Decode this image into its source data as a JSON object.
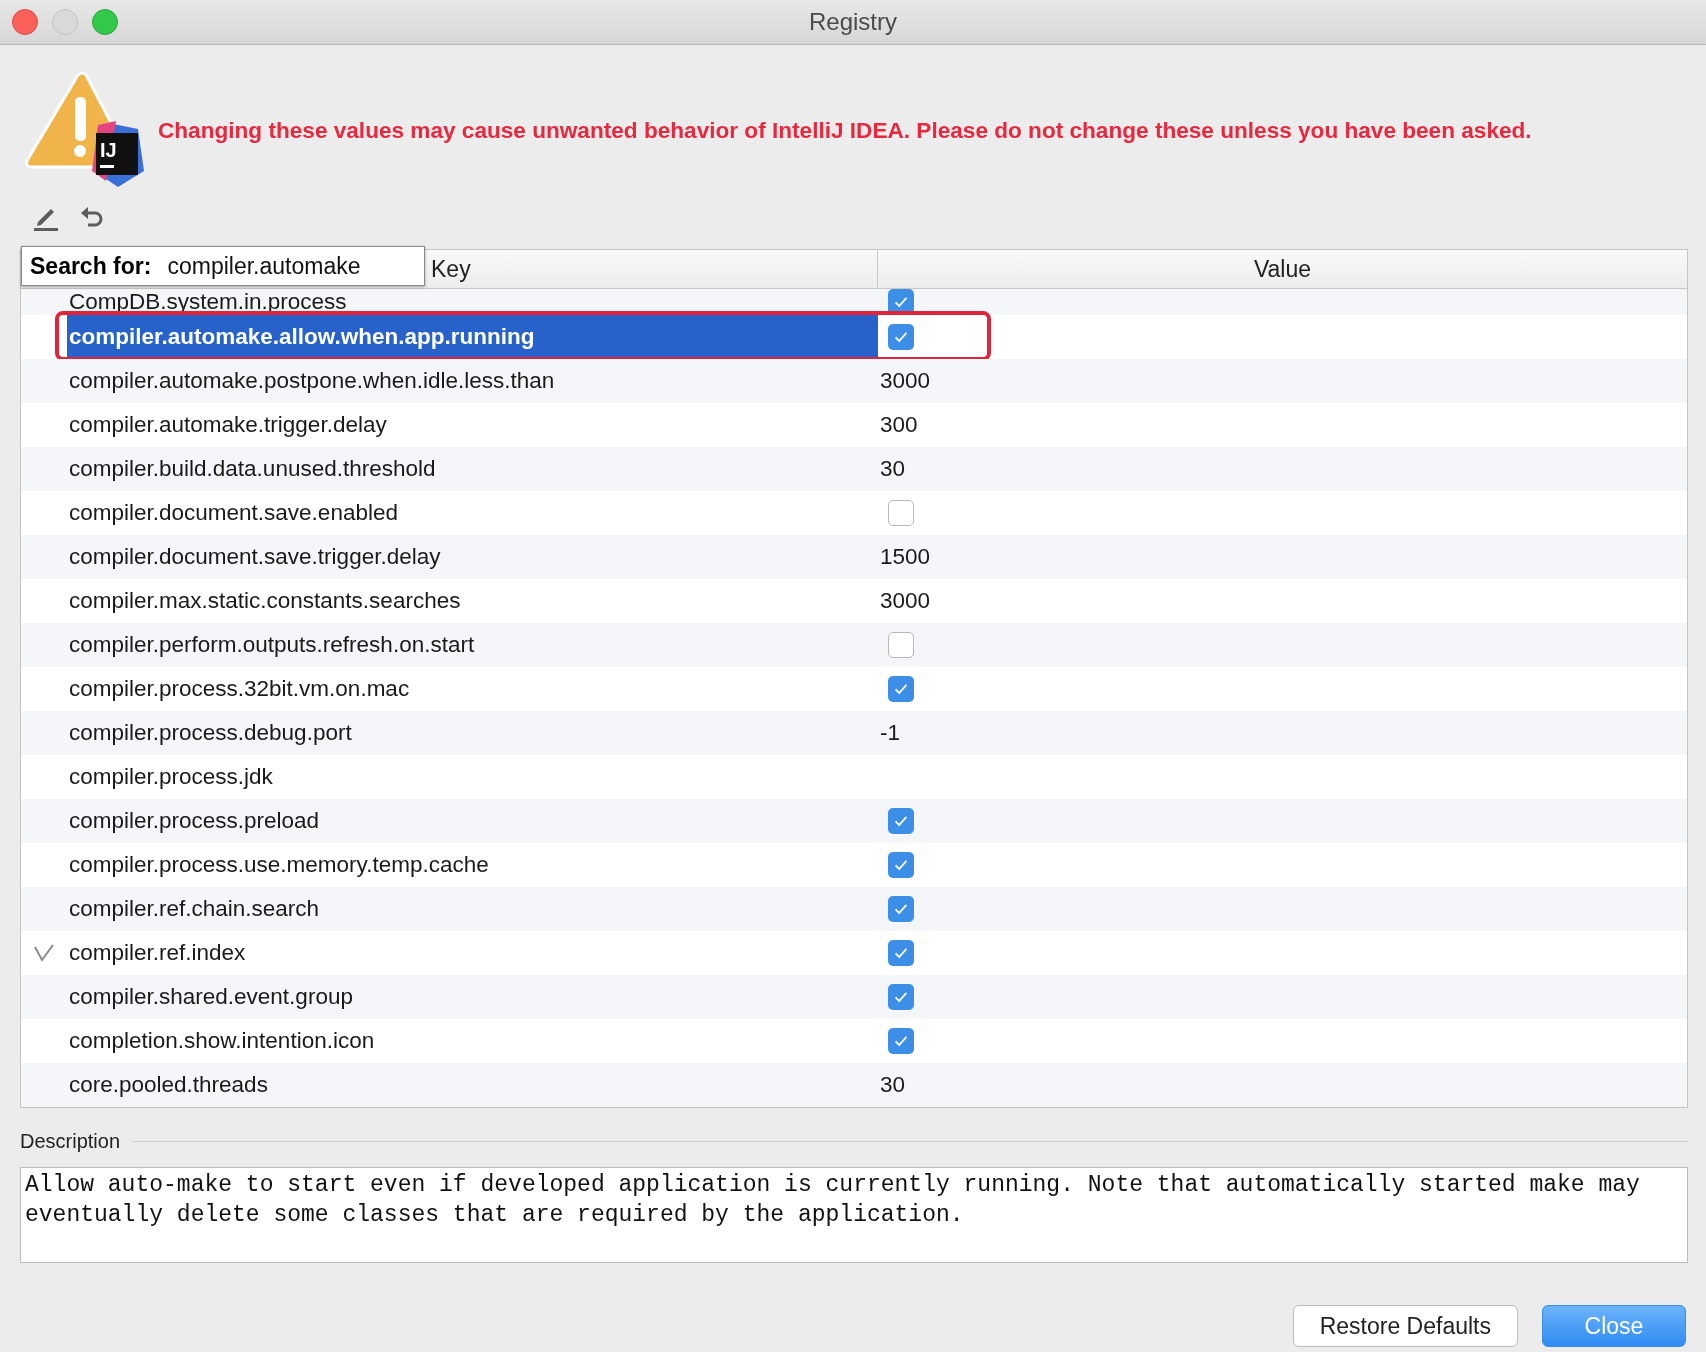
{
  "window": {
    "title": "Registry"
  },
  "badge": "IJ",
  "warning": "Changing these values may cause unwanted behavior of IntelliJ IDEA. Please do not change these unless you have been asked.",
  "search": {
    "label": "Search for:",
    "value": "compiler.automake"
  },
  "table": {
    "columns": [
      "Key",
      "Value"
    ],
    "rows": [
      {
        "key": "CompDB.system.in.process",
        "kind": "bool",
        "checked": true,
        "selected": false,
        "outlined": false,
        "changed": false
      },
      {
        "key": "compiler.automake.allow.when.app.running",
        "kind": "bool",
        "checked": true,
        "selected": true,
        "outlined": true,
        "changed": false
      },
      {
        "key": "compiler.automake.postpone.when.idle.less.than",
        "kind": "text",
        "value": "3000",
        "selected": false,
        "outlined": false,
        "changed": false
      },
      {
        "key": "compiler.automake.trigger.delay",
        "kind": "text",
        "value": "300",
        "selected": false,
        "outlined": false,
        "changed": false
      },
      {
        "key": "compiler.build.data.unused.threshold",
        "kind": "text",
        "value": "30",
        "selected": false,
        "outlined": false,
        "changed": false
      },
      {
        "key": "compiler.document.save.enabled",
        "kind": "bool",
        "checked": false,
        "selected": false,
        "outlined": false,
        "changed": false
      },
      {
        "key": "compiler.document.save.trigger.delay",
        "kind": "text",
        "value": "1500",
        "selected": false,
        "outlined": false,
        "changed": false
      },
      {
        "key": "compiler.max.static.constants.searches",
        "kind": "text",
        "value": "3000",
        "selected": false,
        "outlined": false,
        "changed": false
      },
      {
        "key": "compiler.perform.outputs.refresh.on.start",
        "kind": "bool",
        "checked": false,
        "selected": false,
        "outlined": false,
        "changed": false
      },
      {
        "key": "compiler.process.32bit.vm.on.mac",
        "kind": "bool",
        "checked": true,
        "selected": false,
        "outlined": false,
        "changed": false
      },
      {
        "key": "compiler.process.debug.port",
        "kind": "text",
        "value": "-1",
        "selected": false,
        "outlined": false,
        "changed": false
      },
      {
        "key": "compiler.process.jdk",
        "kind": "text",
        "selected": false,
        "outlined": false,
        "changed": false
      },
      {
        "key": "compiler.process.preload",
        "kind": "bool",
        "checked": true,
        "selected": false,
        "outlined": false,
        "changed": false
      },
      {
        "key": "compiler.process.use.memory.temp.cache",
        "kind": "bool",
        "checked": true,
        "selected": false,
        "outlined": false,
        "changed": false
      },
      {
        "key": "compiler.ref.chain.search",
        "kind": "bool",
        "checked": true,
        "selected": false,
        "outlined": false,
        "changed": false
      },
      {
        "key": "compiler.ref.index",
        "kind": "bool",
        "checked": true,
        "selected": false,
        "outlined": false,
        "changed": true
      },
      {
        "key": "compiler.shared.event.group",
        "kind": "bool",
        "checked": true,
        "selected": false,
        "outlined": false,
        "changed": false
      },
      {
        "key": "completion.show.intention.icon",
        "kind": "bool",
        "checked": true,
        "selected": false,
        "outlined": false,
        "changed": false
      },
      {
        "key": "core.pooled.threads",
        "kind": "text",
        "value": "30",
        "selected": false,
        "outlined": false,
        "changed": false
      }
    ]
  },
  "description": {
    "label": "Description",
    "text": "Allow auto-make to start even if developed application is currently running. Note that automatically started make may eventually delete some classes that are required by the application."
  },
  "buttons": [
    {
      "label": "Restore Defaults",
      "primary": false
    },
    {
      "label": "Close",
      "primary": true
    }
  ]
}
